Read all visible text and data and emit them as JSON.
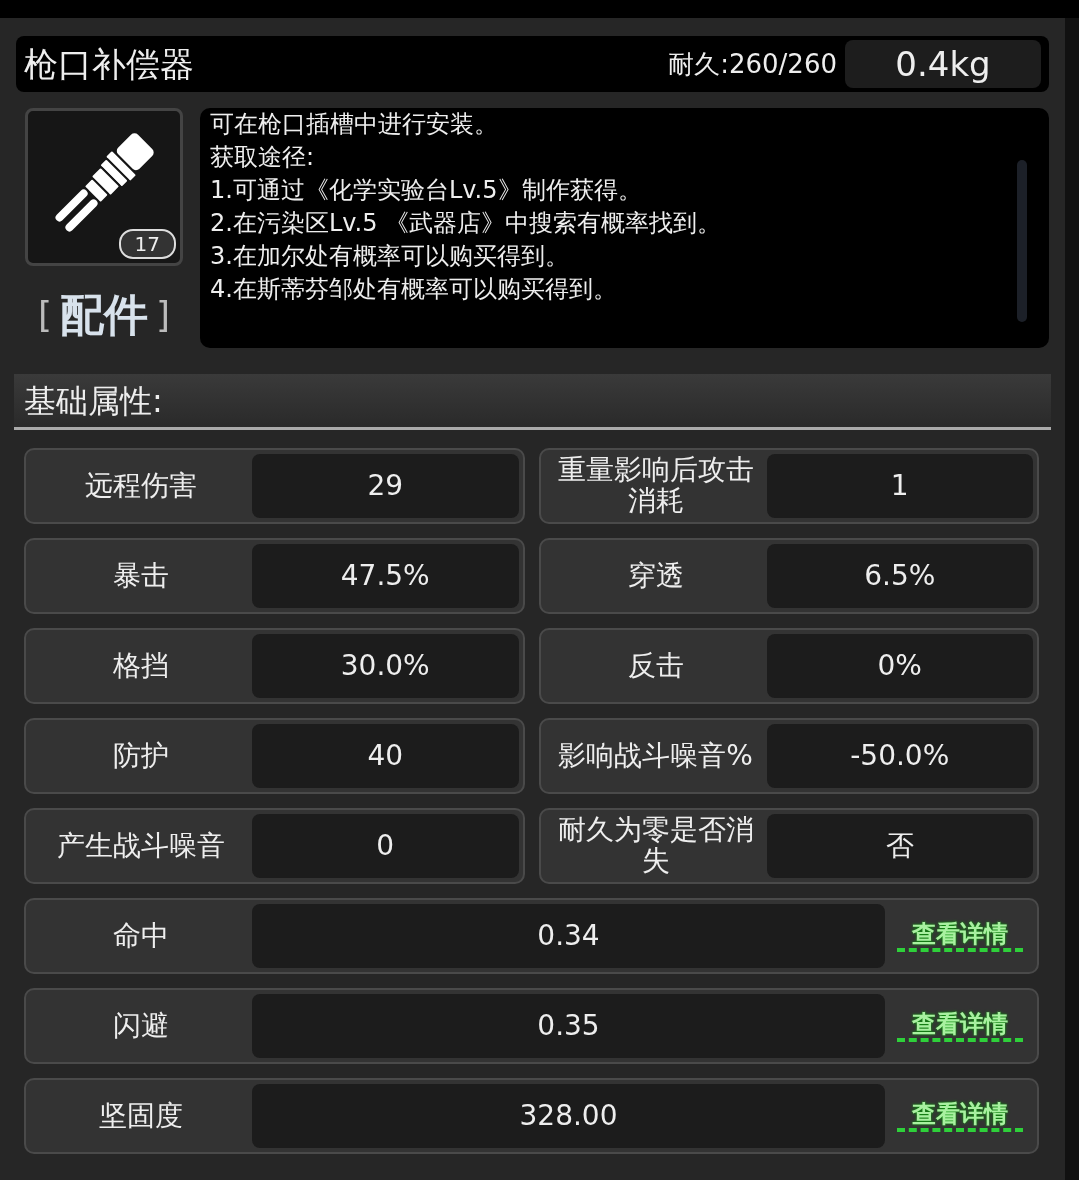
{
  "item": {
    "name": "枪口补偿器",
    "durability": "耐久:260/260",
    "weight": "0.4kg",
    "count": "17",
    "category": "配件",
    "bracket_left": "[",
    "bracket_right": "]"
  },
  "description": [
    "可在枪口插槽中进行安装。",
    "获取途径:",
    "1.可通过《化学实验台Lv.5》制作获得。",
    "2.在污染区Lv.5 《武器店》中搜索有概率找到。",
    "3.在加尔处有概率可以购买得到。",
    "4.在斯蒂芬邹处有概率可以购买得到。"
  ],
  "section_title": "基础属性:",
  "stats": [
    {
      "kind": "half",
      "label": "远程伤害",
      "value": "29"
    },
    {
      "kind": "half",
      "label": "重量影响后攻击消耗",
      "value": "1"
    },
    {
      "kind": "half",
      "label": "暴击",
      "value": "47.5%"
    },
    {
      "kind": "half",
      "label": "穿透",
      "value": "6.5%"
    },
    {
      "kind": "half",
      "label": "格挡",
      "value": "30.0%"
    },
    {
      "kind": "half",
      "label": "反击",
      "value": "0%"
    },
    {
      "kind": "half",
      "label": "防护",
      "value": "40"
    },
    {
      "kind": "half",
      "label": "影响战斗噪音%",
      "value": "-50.0%"
    },
    {
      "kind": "half",
      "label": "产生战斗噪音",
      "value": "0"
    },
    {
      "kind": "half",
      "label": "耐久为零是否消失",
      "value": "否"
    },
    {
      "kind": "full",
      "label": "命中",
      "value": "0.34",
      "link": "查看详情"
    },
    {
      "kind": "full",
      "label": "闪避",
      "value": "0.35",
      "link": "查看详情"
    },
    {
      "kind": "full",
      "label": "坚固度",
      "value": "328.00",
      "link": "查看详情"
    }
  ]
}
